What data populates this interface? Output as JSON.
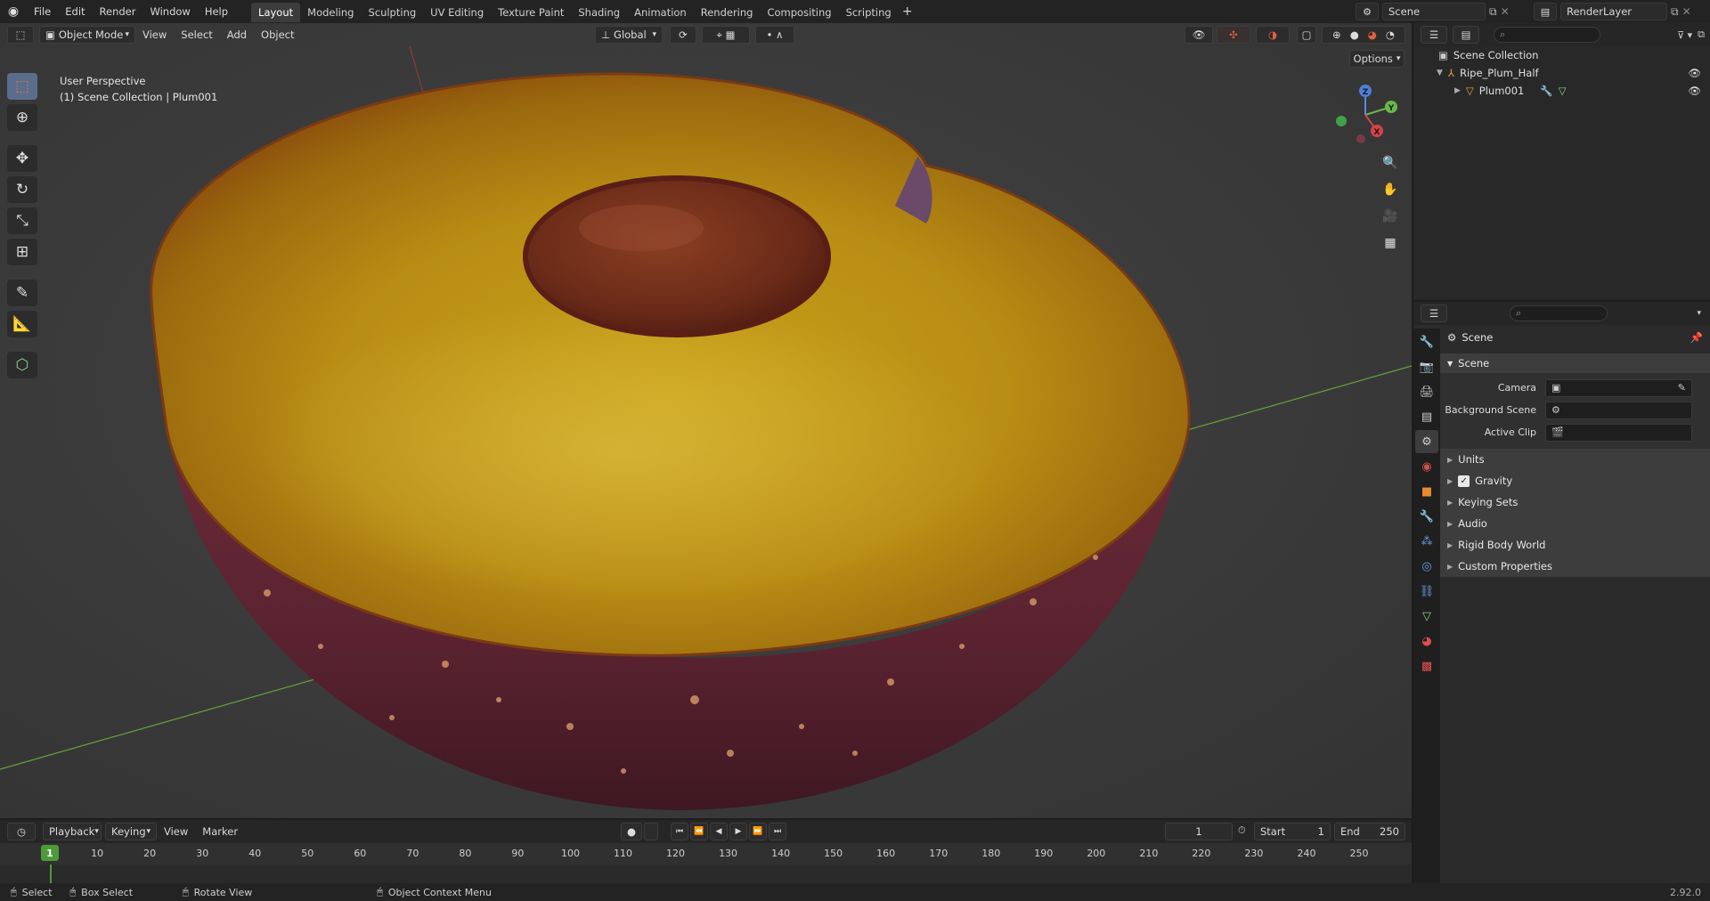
{
  "topbar": {
    "menus": [
      "File",
      "Edit",
      "Render",
      "Window",
      "Help"
    ],
    "workspace_tabs": [
      "Layout",
      "Modeling",
      "Sculpting",
      "UV Editing",
      "Texture Paint",
      "Shading",
      "Animation",
      "Rendering",
      "Compositing",
      "Scripting"
    ],
    "active_tab": "Layout",
    "add_tab": "+",
    "scene_name": "Scene",
    "view_layer": "RenderLayer"
  },
  "viewport": {
    "mode": "Object Mode",
    "menus": [
      "View",
      "Select",
      "Add",
      "Object"
    ],
    "orientation": "Global",
    "options_label": "Options",
    "overlay_line1": "User Perspective",
    "overlay_line2": "(1) Scene Collection | Plum001",
    "gizmo_axes": {
      "z": "Z",
      "y": "Y",
      "x": "X"
    }
  },
  "tools": [
    "select-box",
    "cursor",
    "move",
    "rotate",
    "scale",
    "transform",
    "annotate",
    "measure",
    "add-cube"
  ],
  "outliner": {
    "root": "Scene Collection",
    "items": [
      {
        "name": "Ripe_Plum_Half",
        "indent": 1
      },
      {
        "name": "Plum001",
        "indent": 2
      }
    ]
  },
  "properties": {
    "context_title": "Scene",
    "panel_title": "Scene",
    "fields": [
      {
        "label": "Camera",
        "value": ""
      },
      {
        "label": "Background Scene",
        "value": ""
      },
      {
        "label": "Active Clip",
        "value": ""
      }
    ],
    "subpanels": [
      "Units",
      "Gravity",
      "Keying Sets",
      "Audio",
      "Rigid Body World",
      "Custom Properties"
    ],
    "gravity_checked": true
  },
  "timeline": {
    "menus": [
      "Playback",
      "Keying",
      "View",
      "Marker"
    ],
    "current_frame": "1",
    "start_label": "Start",
    "start": "1",
    "end_label": "End",
    "end": "250",
    "ruler_ticks": [
      "1",
      "10",
      "20",
      "30",
      "40",
      "50",
      "60",
      "70",
      "80",
      "90",
      "100",
      "110",
      "120",
      "130",
      "140",
      "150",
      "160",
      "170",
      "180",
      "190",
      "200",
      "210",
      "220",
      "230",
      "240",
      "250"
    ]
  },
  "statusbar": {
    "select": "Select",
    "box_select": "Box Select",
    "rotate_view": "Rotate View",
    "context_menu": "Object Context Menu",
    "version": "2.92.0"
  }
}
